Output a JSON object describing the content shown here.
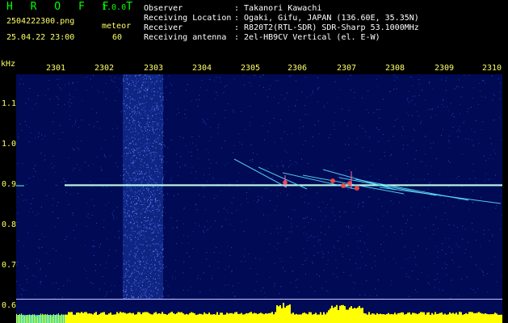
{
  "header": {
    "app_name": "H R O F F T",
    "version": "1.0.0",
    "filename": "2504222300.png",
    "datetime": "25.04.22 23:00",
    "mode_label": "meteor",
    "count": "60",
    "info_labels": [
      "Observer",
      "Receiving Location",
      "Receiver",
      "Receiving antenna"
    ],
    "info_values": [
      ": Takanori Kawachi",
      ": Ogaki, Gifu, JAPAN (136.60E, 35.35N)",
      ": R820T2(RTL-SDR) SDR-Sharp 53.1000MHz",
      ": 2el-HB9CV Vertical (el. E-W)"
    ]
  },
  "axis": {
    "unit_label": "kHz",
    "time_labels": [
      "2301",
      "2302",
      "2303",
      "2304",
      "2305",
      "2306",
      "2307",
      "2308",
      "2309",
      "2310"
    ],
    "freq_labels": [
      "1.1",
      "1.0",
      "0.9",
      "0.8",
      "0.7",
      "0.6"
    ]
  },
  "colors": {
    "background": "#000000",
    "spectrum_bg": "#000a55",
    "title_green": "#00ff00",
    "label_yellow": "#ffff66",
    "signal_line": "#66ffcc",
    "level_bar": "#ffff00",
    "level_base": "#00ccff"
  }
}
